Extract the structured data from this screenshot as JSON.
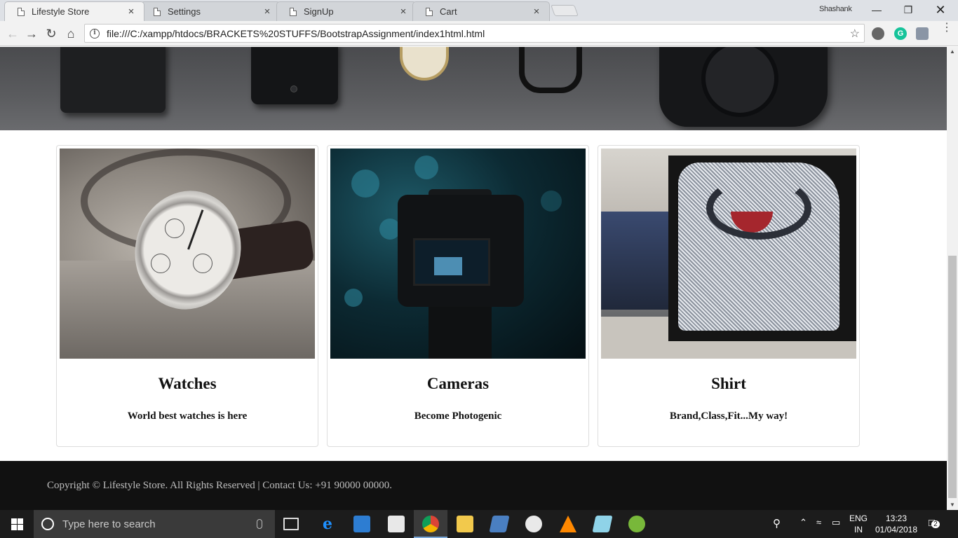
{
  "browser": {
    "tabs": [
      {
        "title": "Lifestyle Store",
        "active": true
      },
      {
        "title": "Settings",
        "active": false
      },
      {
        "title": "SignUp",
        "active": false
      },
      {
        "title": "Cart",
        "active": false
      }
    ],
    "profile_name": "Shashank",
    "url": "file:///C:/xampp/htdocs/BRACKETS%20STUFFS/BootstrapAssignment/index1html.html",
    "close_glyph": "×"
  },
  "page": {
    "cards": [
      {
        "title": "Watches",
        "subtitle": "World best watches is here",
        "image": "watch-photo"
      },
      {
        "title": "Cameras",
        "subtitle": "Become Photogenic",
        "image": "camera-photo"
      },
      {
        "title": "Shirt",
        "subtitle": "Brand,Class,Fit...My way!",
        "image": "shirt-photo"
      }
    ],
    "footer": "Copyright © Lifestyle Store. All Rights Reserved | Contact Us: +91 90000 00000."
  },
  "taskbar": {
    "search_placeholder": "Type here to search",
    "lang_top": "ENG",
    "lang_bottom": "IN",
    "time": "13:23",
    "date": "01/04/2018",
    "notification_count": "2"
  },
  "colors": {
    "footer_bg": "#111111",
    "taskbar_bg": "#1c1c1c",
    "tab_active": "#f2f2f2"
  }
}
